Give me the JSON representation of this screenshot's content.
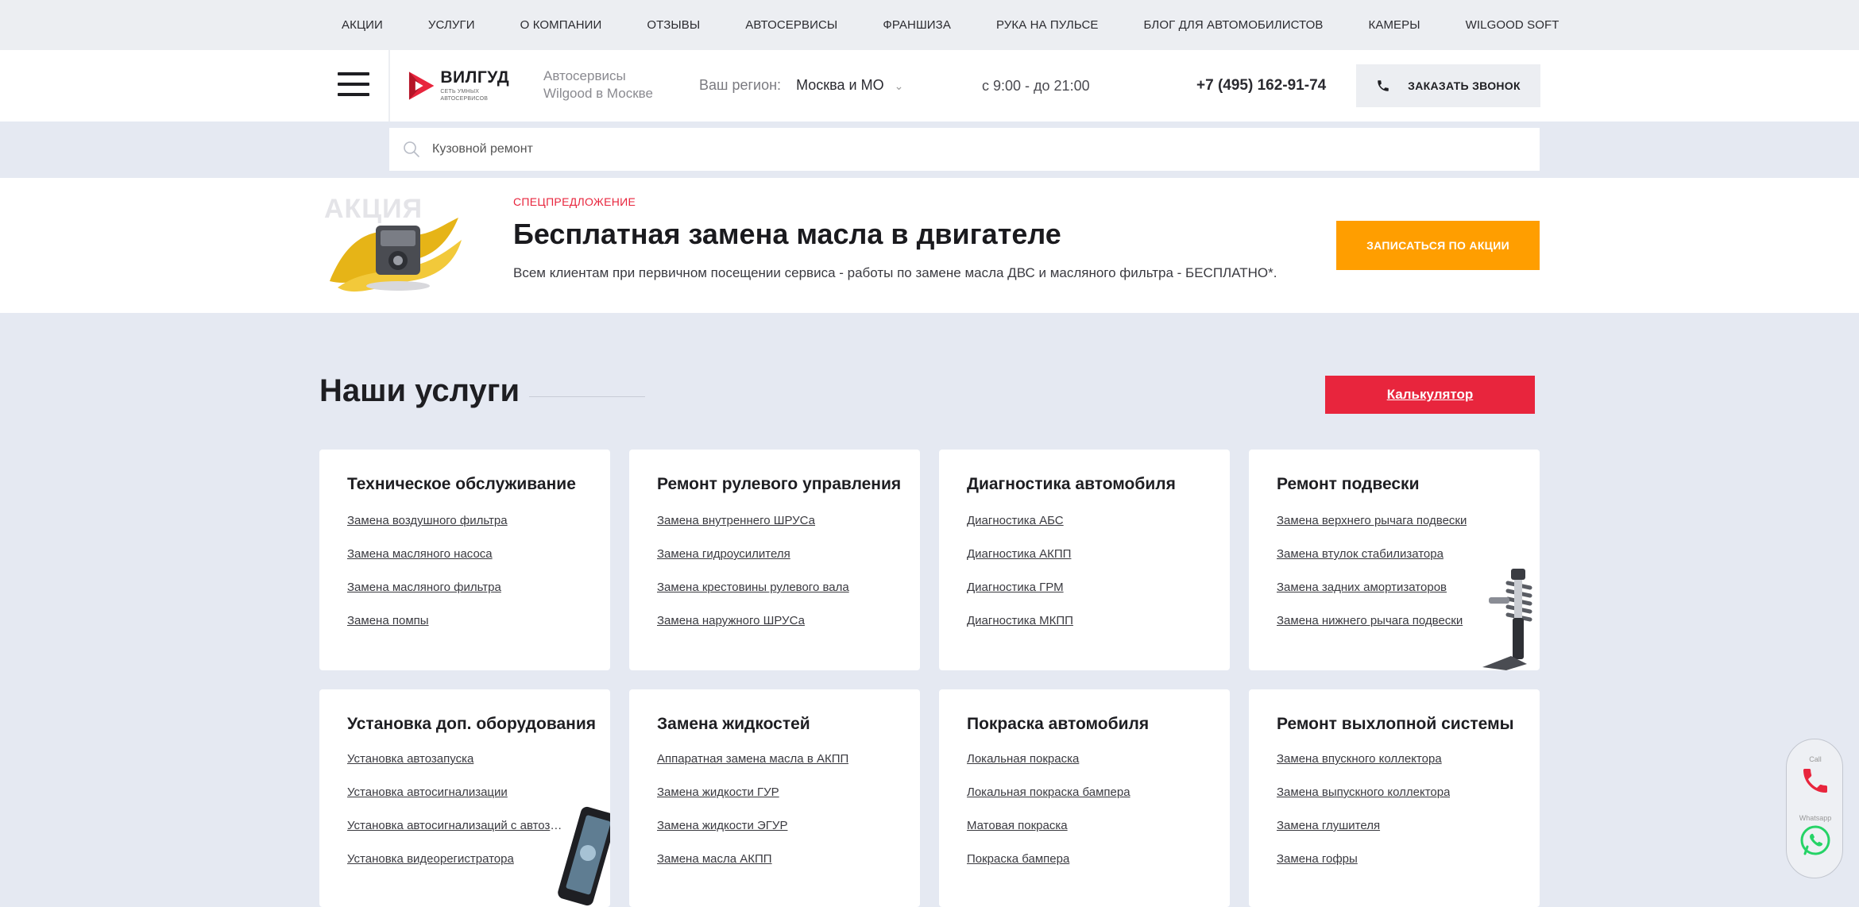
{
  "topnav": {
    "items": [
      "АКЦИИ",
      "УСЛУГИ",
      "О КОМПАНИИ",
      "ОТЗЫВЫ",
      "АВТОСЕРВИСЫ",
      "ФРАНШИЗА",
      "РУКА НА ПУЛЬСЕ",
      "БЛОГ ДЛЯ АВТОМОБИЛИСТОВ",
      "КАМЕРЫ",
      "WILGOOD SOFT"
    ]
  },
  "header": {
    "logo_name": "ВИЛГУД",
    "logo_sub": "СЕТЬ УМНЫХ АВТОСЕРВИСОВ",
    "tagline_line1": "Автосервисы",
    "tagline_line2": "Wilgood в Москве",
    "region_label": "Ваш регион:",
    "region_value": "Москва и МО",
    "hours": "с 9:00 - до 21:00",
    "phone": "+7 (495) 162-91-74",
    "callback_label": "ЗАКАЗАТЬ ЗВОНОК"
  },
  "search": {
    "placeholder": "Кузовной ремонт"
  },
  "promo": {
    "watermark": "АКЦИЯ",
    "tag": "СПЕЦПРЕДЛОЖЕНИЕ",
    "title": "Бесплатная замена масла в двигателе",
    "description": "Всем клиентам при первичном посещении сервиса - работы по замене масла ДВС и масляного фильтра - БЕСПЛАТНО*.",
    "button": "ЗАПИСАТЬСЯ ПО АКЦИИ"
  },
  "services": {
    "title": "Наши услуги",
    "calc_button": "Калькулятор",
    "cards": [
      {
        "title": "Техническое обслуживание",
        "links": [
          "Замена воздушного фильтра",
          "Замена масляного насоса",
          "Замена масляного фильтра",
          "Замена помпы"
        ]
      },
      {
        "title": "Ремонт рулевого управления",
        "links": [
          "Замена внутреннего ШРУСа",
          "Замена гидроусилителя",
          "Замена крестовины рулевого вала",
          "Замена наружного ШРУСа"
        ]
      },
      {
        "title": "Диагностика автомобиля",
        "links": [
          "Диагностика АБС",
          "Диагностика АКПП",
          "Диагностика ГРМ",
          "Диагностика МКПП"
        ]
      },
      {
        "title": "Ремонт подвески",
        "links": [
          "Замена верхнего рычага подвески",
          "Замена втулок стабилизатора",
          "Замена задних амортизаторов",
          "Замена нижнего рычага подвески"
        ]
      },
      {
        "title": "Установка доп. оборудования",
        "links": [
          "Установка автозапуска",
          "Установка автосигнализации",
          "Установка автосигнализаций с автозапуском",
          "Установка видеорегистратора"
        ]
      },
      {
        "title": "Замена жидкостей",
        "links": [
          "Аппаратная замена масла в АКПП",
          "Замена жидкости ГУР",
          "Замена жидкости ЭГУР",
          "Замена масла АКПП"
        ]
      },
      {
        "title": "Покраска автомобиля",
        "links": [
          "Локальная покраска",
          "Локальная покраска бампера",
          "Матовая покраска",
          "Покраска бампера"
        ]
      },
      {
        "title": "Ремонт выхлопной системы",
        "links": [
          "Замена впускного коллектора",
          "Замена выпускного коллектора",
          "Замена глушителя",
          "Замена гофры"
        ]
      }
    ]
  },
  "contact_widget": {
    "call_label": "Call",
    "whatsapp_label": "Whatsapp"
  },
  "colors": {
    "accent_red": "#e8253d",
    "accent_orange": "#ff9e00",
    "page_bg": "#e5e9f2",
    "whatsapp_green": "#25d366"
  }
}
